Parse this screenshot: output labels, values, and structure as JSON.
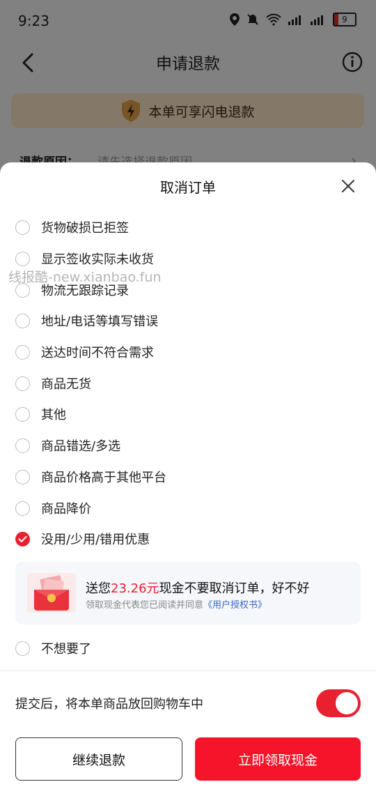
{
  "status_bar": {
    "time": "9:23",
    "battery": "9"
  },
  "nav": {
    "title": "申请退款"
  },
  "flash_banner": {
    "text": "本单可享闪电退款"
  },
  "background_row": {
    "label": "退款原因：",
    "placeholder": "请先选择退款原因"
  },
  "sheet": {
    "title": "取消订单",
    "options": [
      {
        "label": "货物破损已拒签",
        "checked": false
      },
      {
        "label": "显示签收实际未收货",
        "checked": false
      },
      {
        "label": "物流无跟踪记录",
        "checked": false
      },
      {
        "label": "地址/电话等填写错误",
        "checked": false
      },
      {
        "label": "送达时间不符合需求",
        "checked": false
      },
      {
        "label": "商品无货",
        "checked": false
      },
      {
        "label": "其他",
        "checked": false
      },
      {
        "label": "商品错选/多选",
        "checked": false
      },
      {
        "label": "商品价格高于其他平台",
        "checked": false
      },
      {
        "label": "商品降价",
        "checked": false
      },
      {
        "label": "没用/少用/错用优惠",
        "checked": true
      }
    ],
    "cash_offer": {
      "prefix": "送您",
      "amount": "23.26元",
      "suffix": "现金不要取消订单，好不好",
      "note": "领取现金代表您已阅读并同意",
      "link": "《用户授权书》"
    },
    "last_option": {
      "label": "不想要了",
      "checked": false
    },
    "put_back": {
      "label": "提交后，将本单商品放回购物车中",
      "enabled": true
    },
    "buttons": {
      "continue": "继续退款",
      "claim": "立即领取现金"
    }
  },
  "watermark": "线报酷-new.xianbao.fun",
  "colors": {
    "accent": "#e8202f",
    "link": "#3a67c7"
  }
}
